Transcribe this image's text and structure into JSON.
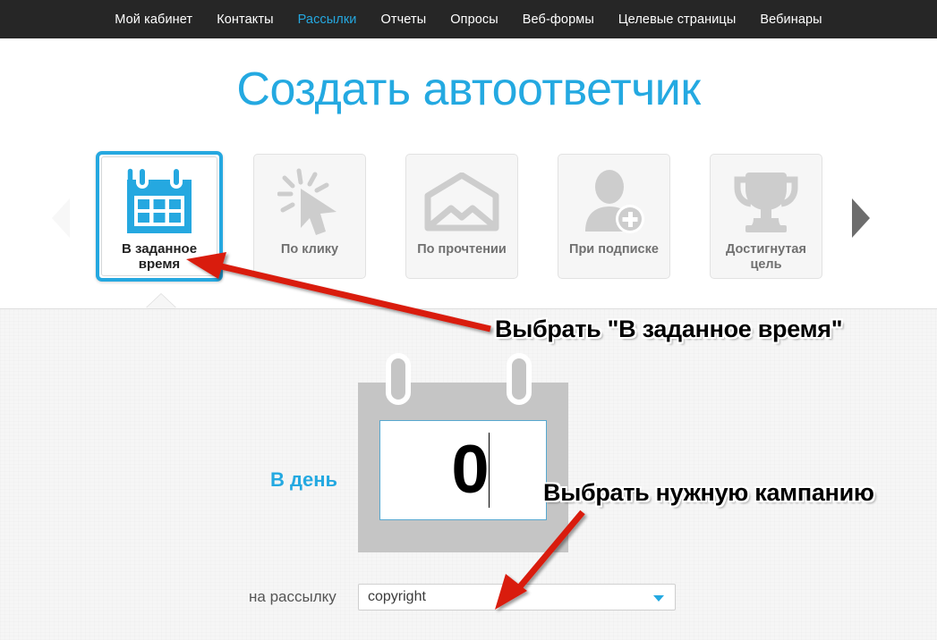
{
  "nav": {
    "items": [
      {
        "label": "Мой кабинет",
        "active": false
      },
      {
        "label": "Контакты",
        "active": false
      },
      {
        "label": "Рассылки",
        "active": true
      },
      {
        "label": "Отчеты",
        "active": false
      },
      {
        "label": "Опросы",
        "active": false
      },
      {
        "label": "Веб-формы",
        "active": false
      },
      {
        "label": "Целевые страницы",
        "active": false
      },
      {
        "label": "Вебинары",
        "active": false
      }
    ]
  },
  "page": {
    "title": "Создать автоответчик",
    "accent_color": "#24a9e1",
    "nav_bg_color": "#262626"
  },
  "tiles": {
    "prev_arrow": "left-triangle-icon",
    "next_arrow": "right-triangle-icon",
    "items": [
      {
        "label": "В заданное\nвремя",
        "label_line1": "В заданное",
        "label_line2": "время",
        "icon": "calendar-icon",
        "selected": true
      },
      {
        "label": "По клику",
        "label_line1": "По клику",
        "label_line2": "",
        "icon": "cursor-click-icon",
        "selected": false
      },
      {
        "label": "По прочтении",
        "label_line1": "По прочтении",
        "label_line2": "",
        "icon": "open-envelope-icon",
        "selected": false
      },
      {
        "label": "При подписке",
        "label_line1": "При подписке",
        "label_line2": "",
        "icon": "user-add-icon",
        "selected": false
      },
      {
        "label": "Достигнутая\nцель",
        "label_line1": "Достигнутая",
        "label_line2": "цель",
        "icon": "trophy-icon",
        "selected": false
      }
    ]
  },
  "form": {
    "day_label": "В день",
    "day_value": "0",
    "list_label": "на рассылку",
    "campaign_value": "copyright",
    "campaign_placeholder": "copyright",
    "campaign_caret": "chevron-down-icon"
  },
  "annotations": [
    {
      "text": "Выбрать \"В заданное время\"",
      "arrow_color": "#d91a10"
    },
    {
      "text": "Выбрать нужную кампанию",
      "arrow_color": "#d91a10"
    }
  ]
}
